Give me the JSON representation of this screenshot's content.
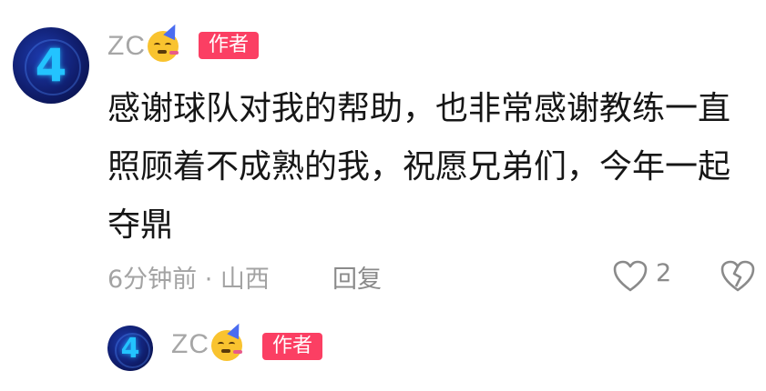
{
  "comment": {
    "author": "ZC",
    "author_badge": "作者",
    "text": "感谢球队对我的帮助，也非常感谢教练一直照顾着不成熟的我，祝愿兄弟们，今年一起夺鼎",
    "time_location": "6分钟前 · 山西",
    "reply_label": "回复",
    "like_count": "2",
    "avatar_number": "4"
  },
  "sub_comment": {
    "author": "ZC",
    "author_badge": "作者",
    "avatar_number": "4"
  },
  "icons": {
    "heart": "heart-outline-icon",
    "dislike": "broken-heart-icon",
    "emoji": "party-face-emoji"
  },
  "colors": {
    "badge_bg": "#fb3f63",
    "username": "#a6a6a6",
    "meta_text": "#a3a3a3"
  }
}
